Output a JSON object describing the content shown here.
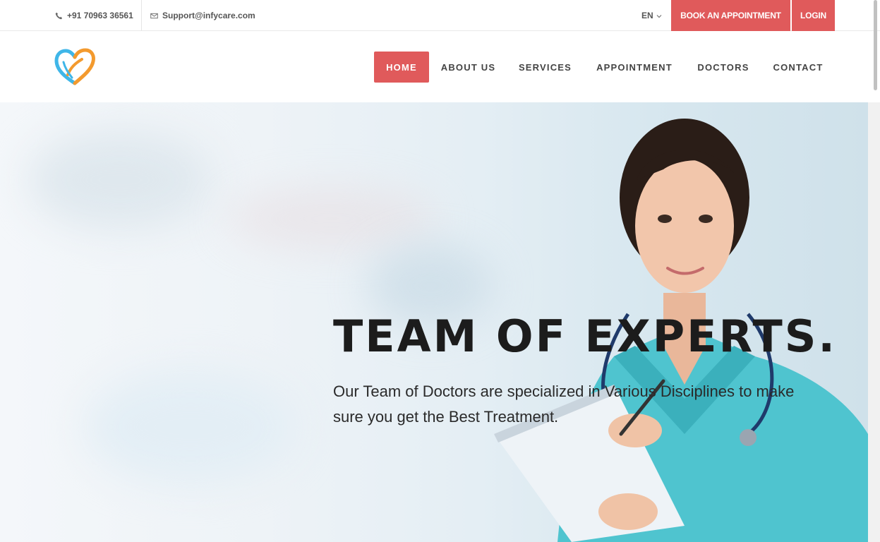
{
  "topbar": {
    "phone": "+91 70963 36561",
    "email": "Support@infycare.com",
    "language": "EN",
    "book_label": "BOOK AN APPOINTMENT",
    "login_label": "LOGIN"
  },
  "nav": {
    "items": [
      {
        "label": "HOME",
        "active": true
      },
      {
        "label": "ABOUT US"
      },
      {
        "label": "SERVICES"
      },
      {
        "label": "APPOINTMENT"
      },
      {
        "label": "DOCTORS"
      },
      {
        "label": "CONTACT"
      }
    ]
  },
  "hero": {
    "title": "TEAM OF EXPERTS.",
    "subtitle": "Our Team of Doctors are specialized in Various Disciplines to make sure you get the Best Treatment."
  },
  "colors": {
    "accent": "#e05a5b",
    "logo_blue": "#3fb6e8",
    "logo_orange": "#f39a2e",
    "scrubs": "#4fc4cf"
  },
  "icons": {
    "phone": "phone-icon",
    "email": "mail-icon",
    "dropdown": "chevron-down-icon",
    "logo": "heart-logo-icon"
  }
}
